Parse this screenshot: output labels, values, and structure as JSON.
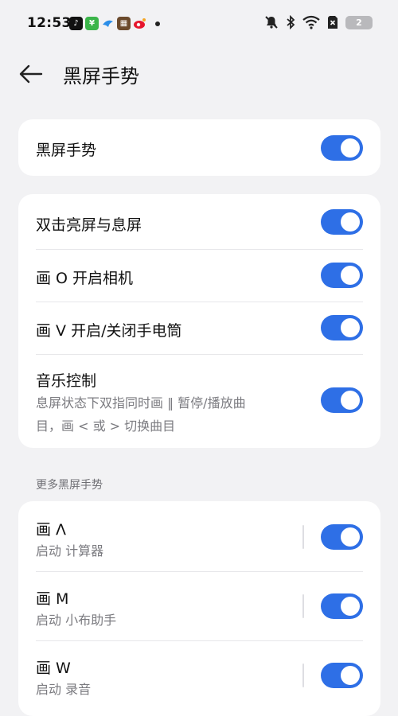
{
  "status_bar": {
    "time": "12:53",
    "notif_icons": [
      "tiktok-icon",
      "wechat-pay-icon",
      "bluebird-icon",
      "news-icon",
      "weibo-icon"
    ],
    "battery_level": "2"
  },
  "header": {
    "title": "黑屏手势"
  },
  "main_toggle": {
    "title": "黑屏手势",
    "enabled": true
  },
  "gestures": [
    {
      "title": "双击亮屏与息屏",
      "enabled": true
    },
    {
      "title": "画 O 开启相机",
      "enabled": true
    },
    {
      "title": "画 V 开启/关闭手电筒",
      "enabled": true
    },
    {
      "title": "音乐控制",
      "subtitle_line1": "息屏状态下双指同时画 ‖ 暂停/播放曲",
      "subtitle_line2": "目，画 < 或 > 切换曲目",
      "enabled": true
    }
  ],
  "more_section": {
    "label": "更多黑屏手势",
    "items": [
      {
        "title": "画 Λ",
        "subtitle": "启动 计算器",
        "enabled": true
      },
      {
        "title": "画 M",
        "subtitle": "启动 小布助手",
        "enabled": true
      },
      {
        "title": "画 W",
        "subtitle": "启动 录音",
        "enabled": true
      }
    ]
  },
  "colors": {
    "accent": "#2e6fe6",
    "background": "#f2f2f4",
    "card": "#ffffff"
  }
}
